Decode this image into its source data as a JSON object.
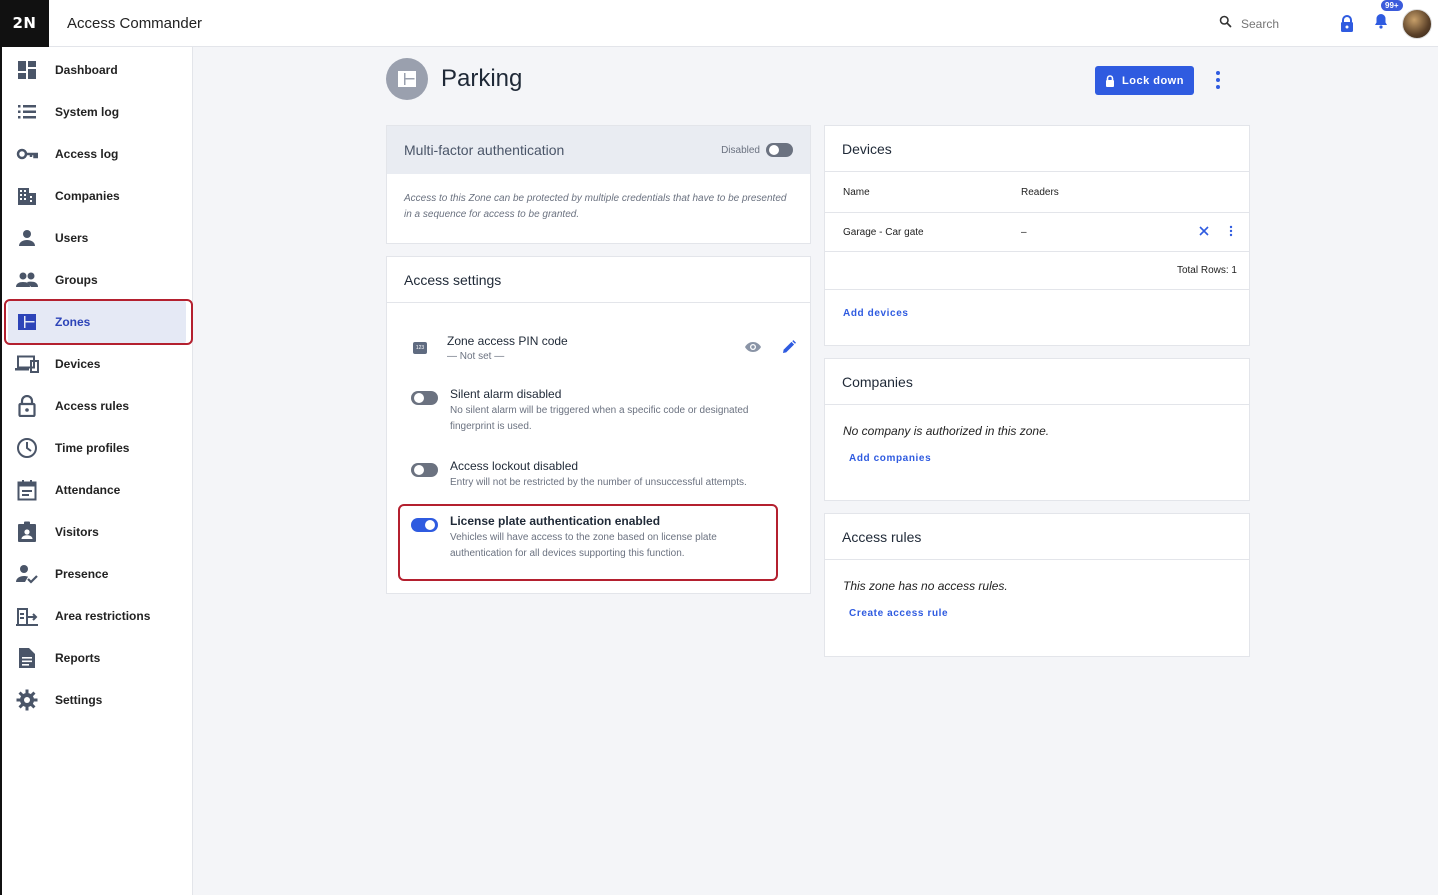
{
  "header": {
    "logo": "2N",
    "app_title": "Access Commander",
    "search_placeholder": "Search",
    "notification_count": "99+"
  },
  "sidebar": {
    "items": [
      {
        "label": "Dashboard",
        "icon": "dashboard-icon"
      },
      {
        "label": "System log",
        "icon": "list-icon"
      },
      {
        "label": "Access log",
        "icon": "key-icon"
      },
      {
        "label": "Companies",
        "icon": "building-icon"
      },
      {
        "label": "Users",
        "icon": "person-icon"
      },
      {
        "label": "Groups",
        "icon": "people-icon"
      },
      {
        "label": "Zones",
        "icon": "zones-icon",
        "active": true
      },
      {
        "label": "Devices",
        "icon": "devices-icon"
      },
      {
        "label": "Access rules",
        "icon": "lock-icon"
      },
      {
        "label": "Time profiles",
        "icon": "clock-icon"
      },
      {
        "label": "Attendance",
        "icon": "calendar-icon"
      },
      {
        "label": "Visitors",
        "icon": "visitor-badge-icon"
      },
      {
        "label": "Presence",
        "icon": "person-check-icon"
      },
      {
        "label": "Area restrictions",
        "icon": "area-icon"
      },
      {
        "label": "Reports",
        "icon": "document-icon"
      },
      {
        "label": "Settings",
        "icon": "gear-icon"
      }
    ]
  },
  "page": {
    "title": "Parking",
    "lockdown_label": "Lock down"
  },
  "mfa": {
    "title": "Multi-factor authentication",
    "status": "Disabled",
    "description": "Access to this Zone can be protected by multiple credentials that have to be presented in a sequence for access to be granted."
  },
  "access_settings": {
    "title": "Access settings",
    "pin": {
      "title": "Zone access PIN code",
      "value": "— Not set —"
    },
    "silent_alarm": {
      "title": "Silent alarm disabled",
      "description": "No silent alarm will be triggered when a specific code or designated fingerprint is used.",
      "enabled": false
    },
    "lockout": {
      "title": "Access lockout disabled",
      "description": "Entry will not be restricted by the number of unsuccessful attempts.",
      "enabled": false
    },
    "license_plate": {
      "title": "License plate authentication enabled",
      "description": "Vehicles will have access to the zone based on license plate authentication for all devices supporting this function.",
      "enabled": true
    }
  },
  "devices": {
    "title": "Devices",
    "columns": [
      "Name",
      "Readers"
    ],
    "rows": [
      {
        "name": "Garage - Car gate",
        "readers": "–"
      }
    ],
    "total_rows": "Total Rows: 1",
    "add_label": "Add devices"
  },
  "companies": {
    "title": "Companies",
    "empty_message": "No company is authorized in this zone.",
    "add_label": "Add companies"
  },
  "access_rules": {
    "title": "Access rules",
    "empty_message": "This zone has no access rules.",
    "create_label": "Create access rule"
  },
  "colors": {
    "accent": "#2f5be0",
    "highlight": "#b4202f"
  }
}
